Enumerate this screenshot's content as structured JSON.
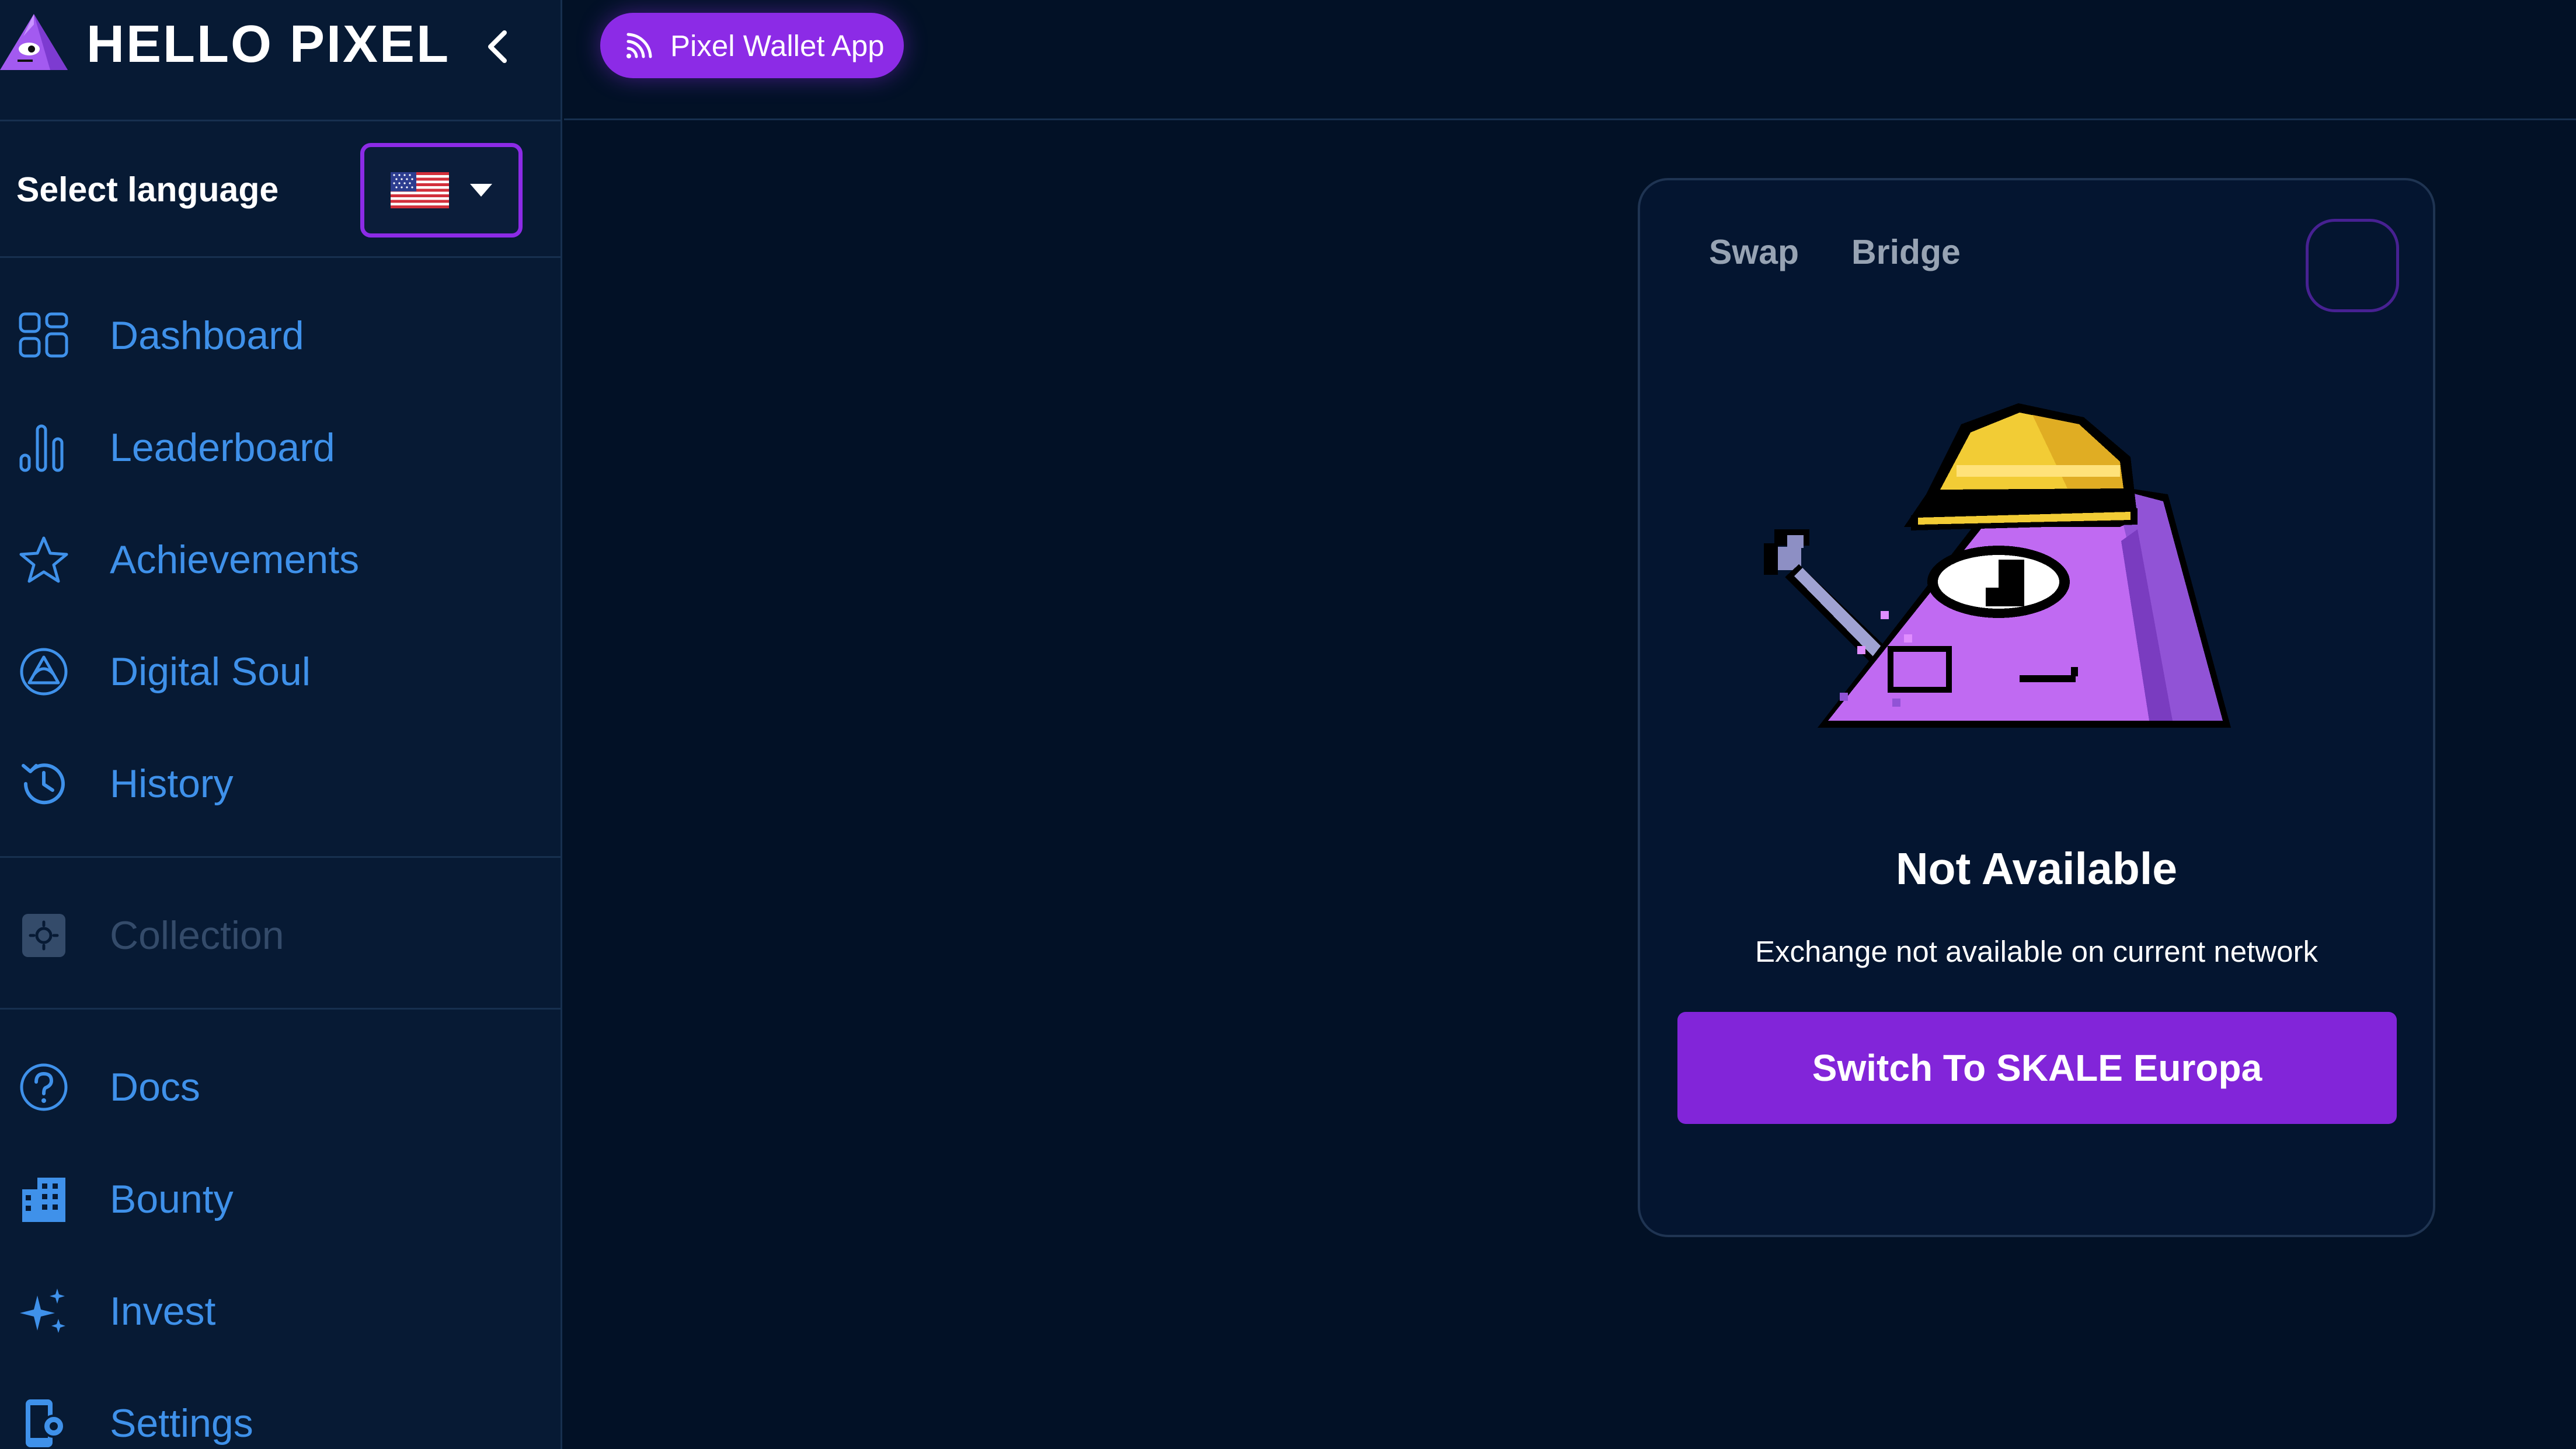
{
  "brand": {
    "title": "HELLO PIXEL",
    "logo": "pixel-triangle-mascot-icon",
    "collapse_icon": "chevron-left-icon"
  },
  "language": {
    "label": "Select language",
    "selected": "us-flag-icon"
  },
  "nav": {
    "group1": [
      {
        "label": "Dashboard",
        "icon": "dashboard-grid-icon"
      },
      {
        "label": "Leaderboard",
        "icon": "bar-chart-icon"
      },
      {
        "label": "Achievements",
        "icon": "star-icon"
      },
      {
        "label": "Digital Soul",
        "icon": "soul-emblem-icon"
      },
      {
        "label": "History",
        "icon": "history-clock-icon"
      }
    ],
    "group2": [
      {
        "label": "Collection",
        "icon": "collection-icon"
      }
    ],
    "group3": [
      {
        "label": "Docs",
        "icon": "help-circle-icon"
      },
      {
        "label": "Bounty",
        "icon": "building-icon"
      },
      {
        "label": "Invest",
        "icon": "sparkles-icon"
      },
      {
        "label": "Settings",
        "icon": "device-settings-icon"
      }
    ]
  },
  "topbar": {
    "wallet_button": "Pixel Wallet App",
    "wallet_icon": "feed-signal-icon"
  },
  "exchange": {
    "tabs": [
      "Swap",
      "Bridge"
    ],
    "status_title": "Not Available",
    "status_message": "Exchange not available on current network",
    "action_button": "Switch To SKALE Europa",
    "illustration": "construction-mascot-with-wrench"
  },
  "colors": {
    "background": "#021126",
    "sidebar": "#071a34",
    "accent": "#8c2be6",
    "nav_text": "#3f91ea",
    "disabled_text": "#344b6a"
  }
}
